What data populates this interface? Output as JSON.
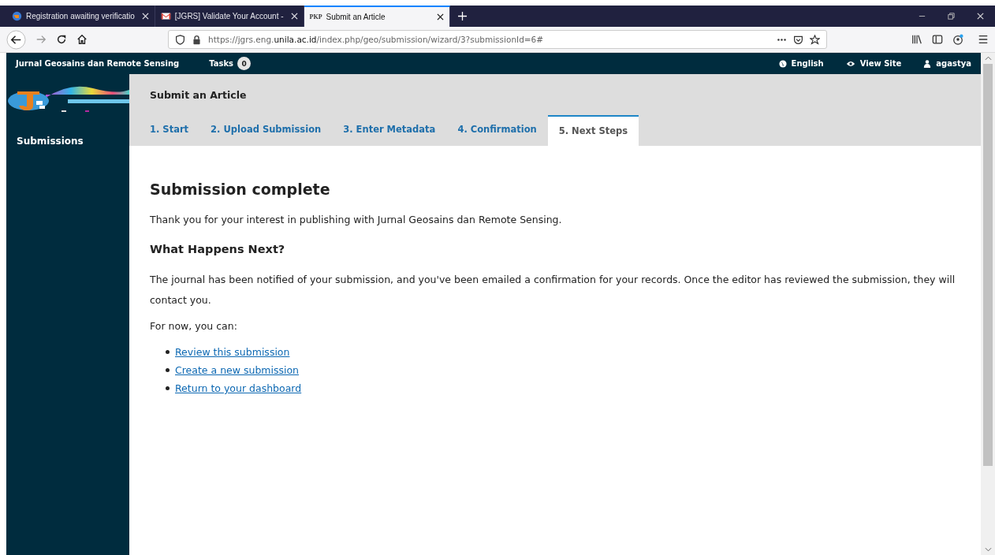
{
  "browser_tabs": [
    {
      "title": "Registration awaiting verificatio",
      "kind": "logo",
      "selected": false
    },
    {
      "title": "[JGRS] Validate Your Account - ",
      "kind": "mail",
      "selected": false
    },
    {
      "title": "Submit an Article",
      "kind": "pkp",
      "icon_text": "PKP",
      "selected": true
    }
  ],
  "address_bar": {
    "url_prefix": "https://jgrs.eng.",
    "url_domain": "unila.ac.id",
    "url_path": "/index.php/geo/submission/wizard/3?submissionId=6#"
  },
  "app_header": {
    "site_name": "Jurnal Geosains dan Remote Sensing",
    "tasks_label": "Tasks",
    "tasks_count": "0",
    "language": "English",
    "view_site": "View Site",
    "user": "agastya"
  },
  "sidebar": {
    "items": [
      {
        "label": "Submissions",
        "selected": true
      }
    ]
  },
  "page": {
    "title": "Submit an Article",
    "steps": [
      {
        "label": "1. Start",
        "selected": false
      },
      {
        "label": "2. Upload Submission",
        "selected": false
      },
      {
        "label": "3. Enter Metadata",
        "selected": false
      },
      {
        "label": "4. Confirmation",
        "selected": false
      },
      {
        "label": "5. Next Steps",
        "selected": true
      }
    ],
    "heading": "Submission complete",
    "thanks": "Thank you for your interest in publishing with Jurnal Geosains dan Remote Sensing.",
    "subheading": "What Happens Next?",
    "notice": "The journal has been notified of your submission, and you've been emailed a confirmation for your records. Once the editor has reviewed the submission, they will contact you.",
    "for_now": "For now, you can:",
    "links": [
      "Review this submission",
      "Create a new submission",
      "Return to your dashboard"
    ]
  }
}
